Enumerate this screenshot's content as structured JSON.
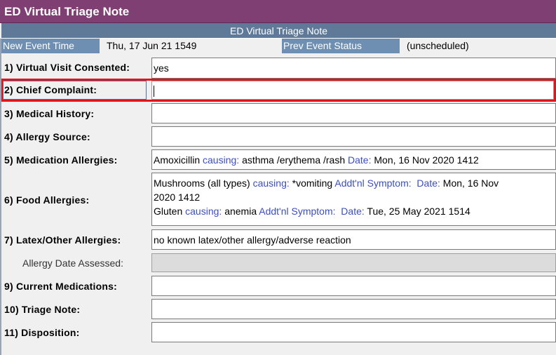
{
  "window": {
    "title": "ED Virtual Triage Note"
  },
  "form": {
    "header": "ED Virtual Triage Note",
    "event_time_label": "New Event Time",
    "event_time_value": "Thu, 17 Jun 21  1549",
    "event_status_label": "Prev Event Status",
    "event_status_value": "(unscheduled)"
  },
  "fields": {
    "virtual_visit": {
      "label": "1)  Virtual Visit Consented:",
      "value": "yes"
    },
    "chief_complaint": {
      "label": "2)  Chief Complaint:",
      "value": ""
    },
    "medical_history": {
      "label": "3)  Medical History:",
      "value": ""
    },
    "allergy_source": {
      "label": "4)  Allergy Source:",
      "value": ""
    },
    "medication_allergies": {
      "label": "5)  Medication Allergies:",
      "allergen": "Amoxicillin",
      "causing_label": "causing:",
      "reaction": "asthma /erythema /rash",
      "date_label": "Date:",
      "date": "Mon, 16 Nov 2020  1412"
    },
    "food_allergies": {
      "label": "6)  Food Allergies:",
      "entries": [
        {
          "allergen": "Mushrooms (all types)",
          "causing_label": "causing:",
          "reaction": "*vomiting",
          "symptom_label": "Addt'nl Symptom:",
          "date_label": "Date:",
          "date_part1": "Mon, 16 Nov",
          "date_part2": "2020  1412"
        },
        {
          "allergen": "Gluten",
          "causing_label": "causing:",
          "reaction": "anemia",
          "symptom_label": "Addt'nl Symptom:",
          "date_label": "Date:",
          "date": "Tue, 25 May 2021  1514"
        }
      ]
    },
    "latex_allergies": {
      "label": "7)  Latex/Other Allergies:",
      "value": "no known latex/other allergy/adverse reaction"
    },
    "allergy_date_assessed": {
      "label": "Allergy Date Assessed:",
      "value": ""
    },
    "current_medications": {
      "label": "9)  Current Medications:",
      "value": ""
    },
    "triage_note": {
      "label": "10)  Triage Note:",
      "value": ""
    },
    "disposition": {
      "label": "11)  Disposition:",
      "value": ""
    }
  },
  "colors": {
    "title_bar": "#7f3f73",
    "header_bar": "#5f7a99",
    "label_cells": "#6e8eb2",
    "focus_highlight": "#e0141b",
    "link_text": "#3a4ec2"
  }
}
